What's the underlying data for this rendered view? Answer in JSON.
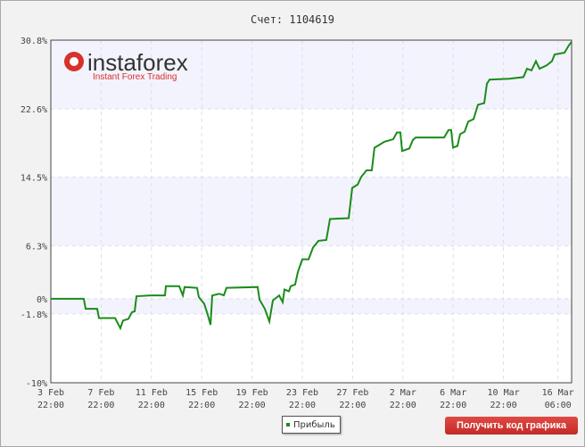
{
  "title": "Счет: 1104619",
  "logo": {
    "name": "instaforex",
    "tagline": "Instant Forex Trading"
  },
  "legend": {
    "label": "Прибыль"
  },
  "button": {
    "label": "Получить код графика"
  },
  "chart_data": {
    "type": "line",
    "title": "Счет: 1104619",
    "xlabel": "",
    "ylabel": "",
    "xunit": "days since 3 Feb 22:00",
    "xlim": [
      0,
      41.42
    ],
    "ylim": [
      -10,
      30.8
    ],
    "y_ticks": [
      {
        "v": 30.8,
        "label": "30.8%"
      },
      {
        "v": 22.6,
        "label": "22.6%"
      },
      {
        "v": 14.5,
        "label": "14.5%"
      },
      {
        "v": 6.3,
        "label": "6.3%"
      },
      {
        "v": 0,
        "label": "0%"
      },
      {
        "v": -1.8,
        "label": "-1.8%"
      },
      {
        "v": -10,
        "label": "-10%"
      }
    ],
    "x_ticks": [
      {
        "v": 0,
        "l1": "3 Feb",
        "l2": "22:00"
      },
      {
        "v": 4,
        "l1": "7 Feb",
        "l2": "22:00"
      },
      {
        "v": 8,
        "l1": "11 Feb",
        "l2": "22:00"
      },
      {
        "v": 12,
        "l1": "15 Feb",
        "l2": "22:00"
      },
      {
        "v": 16,
        "l1": "19 Feb",
        "l2": "22:00"
      },
      {
        "v": 20,
        "l1": "23 Feb",
        "l2": "22:00"
      },
      {
        "v": 24,
        "l1": "27 Feb",
        "l2": "22:00"
      },
      {
        "v": 28,
        "l1": "2 Mar",
        "l2": "22:00"
      },
      {
        "v": 32,
        "l1": "6 Mar",
        "l2": "22:00"
      },
      {
        "v": 36,
        "l1": "10 Mar",
        "l2": "22:00"
      },
      {
        "v": 40.33,
        "l1": "16 Mar",
        "l2": "06:00"
      }
    ],
    "bands": [
      [
        22.6,
        30.8
      ],
      [
        6.3,
        14.5
      ],
      [
        -1.8,
        0
      ]
    ],
    "legend": "bottom-center",
    "series": [
      {
        "name": "Прибыль",
        "color": "#1a8c1a",
        "points": [
          [
            0,
            0
          ],
          [
            2.62,
            0
          ],
          [
            2.77,
            -1.2
          ],
          [
            3.69,
            -1.2
          ],
          [
            3.83,
            -2.3
          ],
          [
            5.11,
            -2.3
          ],
          [
            5.53,
            -3.5
          ],
          [
            5.74,
            -2.6
          ],
          [
            6.17,
            -2.4
          ],
          [
            6.45,
            -1.6
          ],
          [
            6.67,
            -1.5
          ],
          [
            6.81,
            0.3
          ],
          [
            7.94,
            0.4
          ],
          [
            9.08,
            0.4
          ],
          [
            9.15,
            1.5
          ],
          [
            10.21,
            1.5
          ],
          [
            10.5,
            0.4
          ],
          [
            10.64,
            1.4
          ],
          [
            11.63,
            1.3
          ],
          [
            11.77,
            0.2
          ],
          [
            12.2,
            -0.6
          ],
          [
            12.48,
            -1.9
          ],
          [
            12.7,
            -3.1
          ],
          [
            12.84,
            0.4
          ],
          [
            13.4,
            0.6
          ],
          [
            13.76,
            0.4
          ],
          [
            13.97,
            1.3
          ],
          [
            16.45,
            1.4
          ],
          [
            16.6,
            -0.1
          ],
          [
            17.02,
            -1.2
          ],
          [
            17.38,
            -2.7
          ],
          [
            17.66,
            -0.2
          ],
          [
            18.16,
            0.4
          ],
          [
            18.44,
            -0.4
          ],
          [
            18.58,
            1.1
          ],
          [
            18.94,
            0.9
          ],
          [
            19.08,
            1.5
          ],
          [
            19.43,
            1.7
          ],
          [
            19.65,
            3.2
          ],
          [
            20,
            4.7
          ],
          [
            20.5,
            4.7
          ],
          [
            20.85,
            6.1
          ],
          [
            21.28,
            6.9
          ],
          [
            21.91,
            7.0
          ],
          [
            22.2,
            9.5
          ],
          [
            23.69,
            9.6
          ],
          [
            23.97,
            13.2
          ],
          [
            24.4,
            13.6
          ],
          [
            24.68,
            14.5
          ],
          [
            25.11,
            15.3
          ],
          [
            25.53,
            15.3
          ],
          [
            25.74,
            18.0
          ],
          [
            26.1,
            18.3
          ],
          [
            26.52,
            18.7
          ],
          [
            27.23,
            19.0
          ],
          [
            27.52,
            19.8
          ],
          [
            27.8,
            19.8
          ],
          [
            27.94,
            17.6
          ],
          [
            28.51,
            17.9
          ],
          [
            28.79,
            18.9
          ],
          [
            29.01,
            19.2
          ],
          [
            31.28,
            19.2
          ],
          [
            31.63,
            20.1
          ],
          [
            31.84,
            20.1
          ],
          [
            31.99,
            18.0
          ],
          [
            32.34,
            18.2
          ],
          [
            32.55,
            19.6
          ],
          [
            32.91,
            19.9
          ],
          [
            33.19,
            21.1
          ],
          [
            33.62,
            21.4
          ],
          [
            33.97,
            23.1
          ],
          [
            34.47,
            23.3
          ],
          [
            34.68,
            25.6
          ],
          [
            34.89,
            26.1
          ],
          [
            36.45,
            26.2
          ],
          [
            37.59,
            26.4
          ],
          [
            37.87,
            27.4
          ],
          [
            38.23,
            27.2
          ],
          [
            38.58,
            28.3
          ],
          [
            38.87,
            27.4
          ],
          [
            39.43,
            27.8
          ],
          [
            39.86,
            28.3
          ],
          [
            40.07,
            29.1
          ],
          [
            40.85,
            29.3
          ],
          [
            41.21,
            30.2
          ],
          [
            41.42,
            30.6
          ]
        ]
      }
    ]
  }
}
